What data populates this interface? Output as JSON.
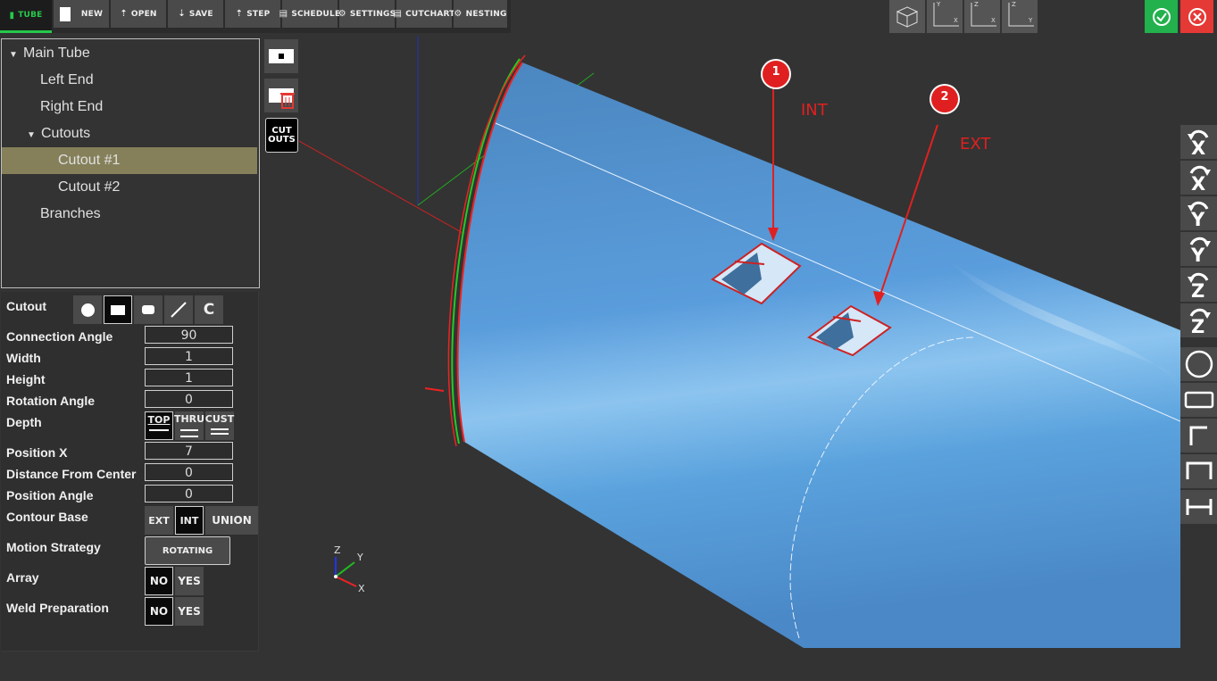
{
  "toolbar": {
    "items": [
      {
        "label": "TUBE",
        "icon": "file-icon"
      },
      {
        "label": "NEW",
        "icon": "new-file-icon"
      },
      {
        "label": "OPEN",
        "icon": "upload-icon"
      },
      {
        "label": "SAVE",
        "icon": "download-icon"
      },
      {
        "label": "STEP",
        "icon": "upload-icon"
      },
      {
        "label": "SCHEDULE",
        "icon": "file-icon"
      },
      {
        "label": "SETTINGS",
        "icon": "gear-icon"
      },
      {
        "label": "CUTCHART",
        "icon": "file-icon"
      },
      {
        "label": "NESTING",
        "icon": "gear-icon"
      }
    ]
  },
  "tree": {
    "items": [
      {
        "label": "Main Tube",
        "expanded": true
      },
      {
        "label": "Left End"
      },
      {
        "label": "Right End"
      },
      {
        "label": "Cutouts",
        "expanded": true
      },
      {
        "label": "Cutout #1",
        "selected": true
      },
      {
        "label": "Cutout #2"
      },
      {
        "label": "Branches"
      }
    ]
  },
  "side_buttons": {
    "cutouts_line1": "CUT",
    "cutouts_line2": "OUTS"
  },
  "props": {
    "cutout_label": "Cutout",
    "connection_angle": {
      "label": "Connection Angle",
      "value": "90"
    },
    "width": {
      "label": "Width",
      "value": "1"
    },
    "height": {
      "label": "Height",
      "value": "1"
    },
    "rotation_angle": {
      "label": "Rotation Angle",
      "value": "0"
    },
    "depth": {
      "label": "Depth",
      "options": [
        "TOP",
        "THRU",
        "CUST"
      ],
      "selected": "TOP"
    },
    "position_x": {
      "label": "Position X",
      "value": "7"
    },
    "distance_from_center": {
      "label": "Distance From Center",
      "value": "0"
    },
    "position_angle": {
      "label": "Position Angle",
      "value": "0"
    },
    "contour_base": {
      "label": "Contour Base",
      "options": [
        "EXT",
        "INT",
        "UNION"
      ],
      "selected": "INT"
    },
    "motion_strategy": {
      "label": "Motion Strategy",
      "value": "ROTATING"
    },
    "array": {
      "label": "Array",
      "options": [
        "NO",
        "YES"
      ],
      "selected": "NO"
    },
    "weld_preparation": {
      "label": "Weld Preparation",
      "options": [
        "NO",
        "YES"
      ],
      "selected": "NO"
    }
  },
  "viewport": {
    "annotations": [
      {
        "number": "1",
        "text": "INT"
      },
      {
        "number": "2",
        "text": "EXT"
      }
    ],
    "axes": {
      "x": "X",
      "y": "Y",
      "z": "Z"
    },
    "tube_color": "#5b9fd9",
    "annotation_color": "#e02020"
  },
  "view_buttons": [
    {
      "name": "iso"
    },
    {
      "name": "xy",
      "a": "Y",
      "b": "X"
    },
    {
      "name": "zx",
      "a": "Z",
      "b": "X"
    },
    {
      "name": "zy",
      "a": "Z",
      "b": "Y"
    }
  ],
  "right_tools": [
    {
      "axis": "X",
      "dir": "ccw"
    },
    {
      "axis": "X",
      "dir": "cw"
    },
    {
      "axis": "Y",
      "dir": "ccw"
    },
    {
      "axis": "Y",
      "dir": "cw"
    },
    {
      "axis": "Z",
      "dir": "ccw"
    },
    {
      "axis": "Z",
      "dir": "cw"
    }
  ]
}
